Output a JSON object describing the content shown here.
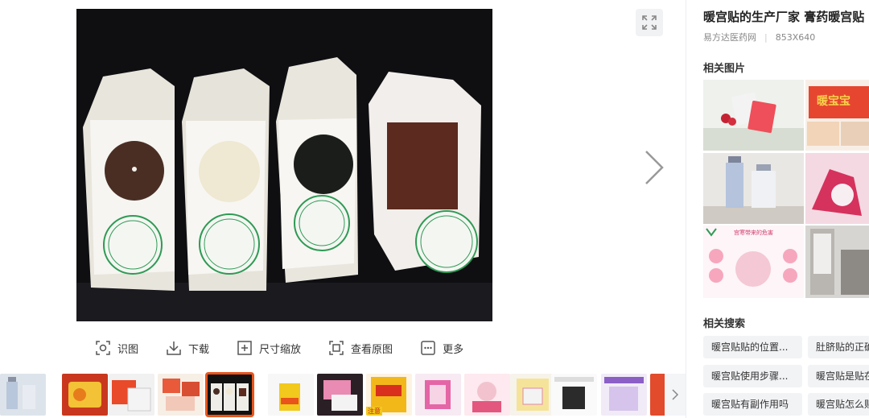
{
  "viewer": {
    "toolbar": [
      {
        "label": "识图",
        "icon": "scan-icon"
      },
      {
        "label": "下载",
        "icon": "download-icon"
      },
      {
        "label": "尺寸缩放",
        "icon": "resize-icon"
      },
      {
        "label": "查看原图",
        "icon": "original-image-icon"
      },
      {
        "label": "更多",
        "icon": "more-icon"
      }
    ],
    "film_badges": {
      "pack1": "注意"
    }
  },
  "sidebar": {
    "title": "暖宫贴的生产厂家 膏药暖宫贴",
    "source": "易方达医药网",
    "dimensions": "853X640",
    "related_images_heading": "相关图片",
    "related_image_texts": {
      "warm_baby": "暖宝宝",
      "infographic_header": "宫寒带来的危害"
    },
    "related_search_heading": "相关搜索",
    "related_searches": [
      "暖宫贴贴的位置...",
      "肚脐贴的正确",
      "暖宫贴使用步骤...",
      "暖宫贴是贴在",
      "暖宫贴有副作用吗",
      "暖宫贴怎么贴"
    ]
  },
  "colors": {
    "accent": "#e8541c",
    "tag_bg": "#f2f3f5",
    "photo_bg": "#0f0f12"
  }
}
